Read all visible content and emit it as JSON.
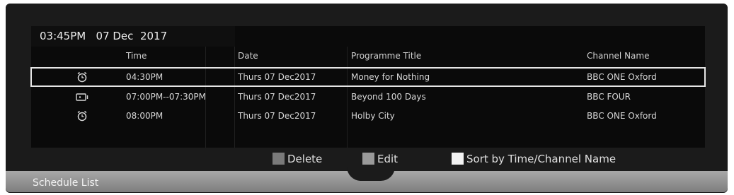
{
  "datetime": {
    "time": "03:45PM",
    "date": "07 Dec  2017"
  },
  "columns": {
    "time": "Time",
    "date": "Date",
    "title": "Programme Title",
    "channel": "Channel Name"
  },
  "rows": [
    {
      "icon": "alarm-clock-icon",
      "time": "04:30PM",
      "date": "Thurs  07  Dec2017",
      "title": "Money for Nothing",
      "channel": "BBC ONE Oxford",
      "selected": true
    },
    {
      "icon": "record-icon",
      "time": "07:00PM--07:30PM",
      "date": "Thurs  07  Dec2017",
      "title": "Beyond 100 Days",
      "channel": "BBC FOUR",
      "selected": false
    },
    {
      "icon": "alarm-clock-icon",
      "time": "08:00PM",
      "date": "Thurs  07  Dec2017",
      "title": "Holby City",
      "channel": "BBC ONE Oxford",
      "selected": false
    }
  ],
  "legend": {
    "delete": {
      "label": "Delete",
      "color": "#7a7a7a"
    },
    "edit": {
      "label": "Edit",
      "color": "#9a9a9a"
    },
    "sort": {
      "label": "Sort by Time/Channel Name",
      "color": "#f2f2f2"
    }
  },
  "footer": {
    "title": "Schedule List"
  }
}
